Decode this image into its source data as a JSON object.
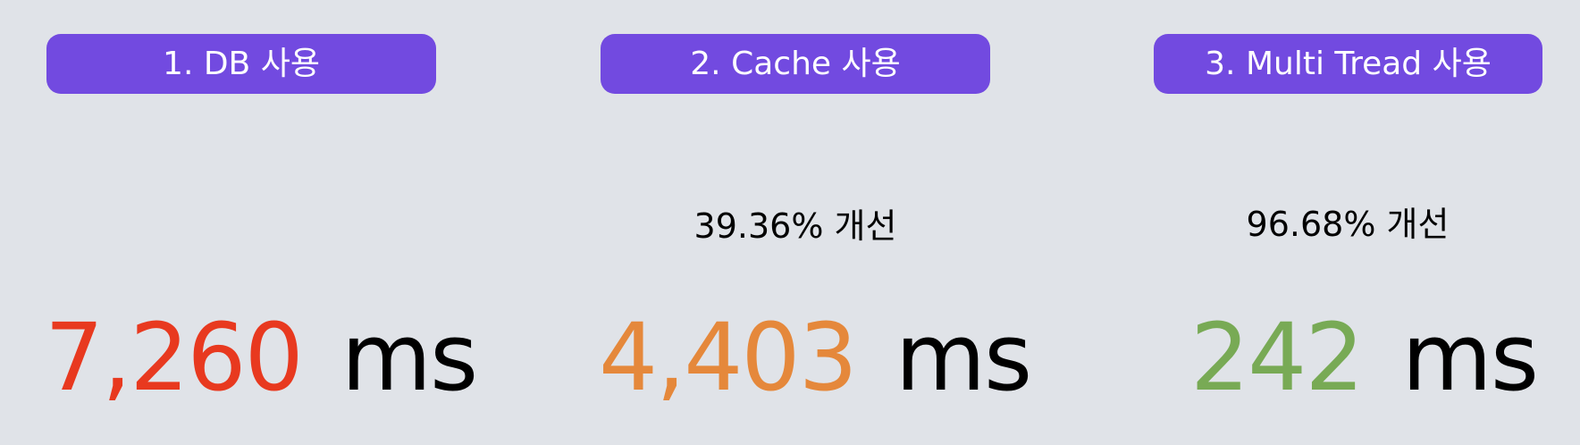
{
  "cards": [
    {
      "title": "1. DB 사용",
      "improvement": "",
      "value": "7,260",
      "unit": "ms",
      "value_color": "#e8391f"
    },
    {
      "title": "2. Cache 사용",
      "improvement": "39.36% 개선",
      "value": "4,403",
      "unit": "ms",
      "value_color": "#e5883b"
    },
    {
      "title": "3. Multi Tread 사용",
      "improvement": "96.68% 개선",
      "value": "242",
      "unit": "ms",
      "value_color": "#78aa55"
    }
  ]
}
